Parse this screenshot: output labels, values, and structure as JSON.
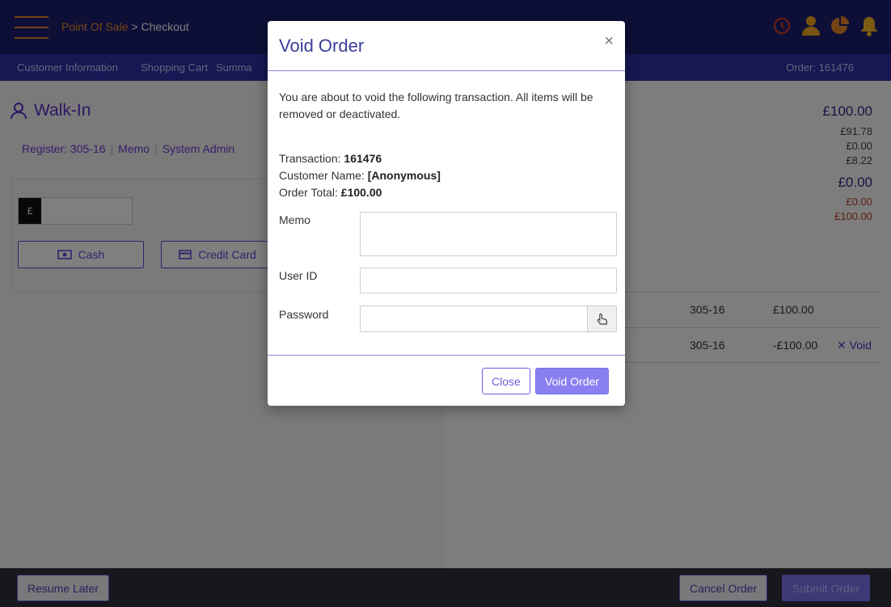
{
  "header": {
    "breadcrumb_link": "Point Of Sale",
    "breadcrumb_sep": " > ",
    "breadcrumb_current": "Checkout"
  },
  "subnav": {
    "tabs": [
      "Customer Information",
      "Shopping Cart",
      "Summa"
    ],
    "order_label": "Order: 161476"
  },
  "customer": {
    "name": "Walk-In",
    "register": "Register: 305-16",
    "memo": "Memo",
    "user": "System Admin"
  },
  "payment": {
    "currency_symbol": "£",
    "cash_label": "Cash",
    "card_label": "Credit Card"
  },
  "totals": [
    "£100.00",
    "£91.78",
    "£0.00",
    "£8.22",
    "£0.00",
    "£0.00",
    "£100.00"
  ],
  "transactions": [
    {
      "register": "305-16",
      "amount": "£100.00",
      "action": ""
    },
    {
      "register": "305-16",
      "amount": "-£100.00",
      "action": "Void"
    }
  ],
  "footer": {
    "resume_label": "Resume Later",
    "cancel_label": "Cancel Order",
    "submit_label": "Submit Order"
  },
  "modal": {
    "title": "Void Order",
    "close_glyph": "×",
    "message": "You are about to void the following transaction. All items will be removed or deactivated.",
    "transaction_label": "Transaction: ",
    "transaction_value": "161476",
    "customer_label": "Customer Name:  ",
    "customer_value": "[Anonymous]",
    "total_label": "Order Total: ",
    "total_value": "£100.00",
    "memo_label": "Memo",
    "memo_value": "",
    "userid_label": "User ID",
    "userid_value": "",
    "password_label": "Password",
    "password_value": "",
    "close_button": "Close",
    "void_button": "Void Order"
  }
}
